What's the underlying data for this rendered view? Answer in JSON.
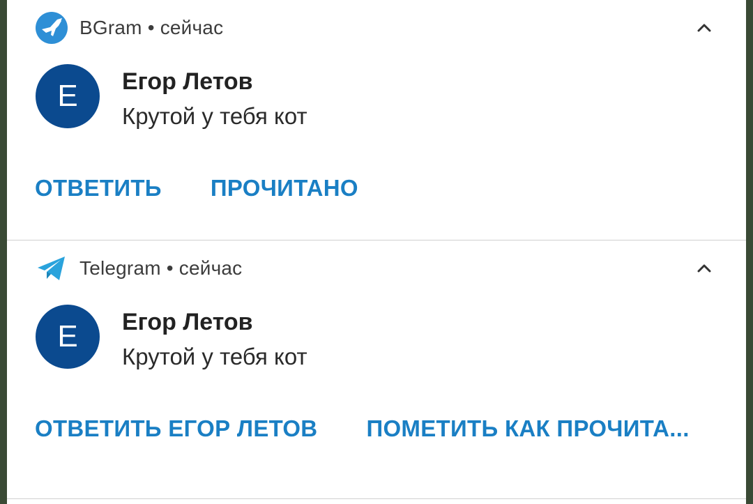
{
  "colors": {
    "accent": "#1a7fc4",
    "avatar_bg": "#0b4a8f",
    "bgram_icon": "#2e8fd6",
    "telegram_icon": "#2aa3dc"
  },
  "notifications": [
    {
      "app_name": "BGram",
      "time_sep": "•",
      "time": "сейчас",
      "app_icon": "bgram-bird-icon",
      "avatar_letter": "Е",
      "sender": "Егор Летов",
      "message": "Крутой у тебя кот",
      "actions": [
        "ОТВЕТИТЬ",
        "ПРОЧИТАНО"
      ]
    },
    {
      "app_name": "Telegram",
      "time_sep": "•",
      "time": "сейчас",
      "app_icon": "telegram-paper-plane-icon",
      "avatar_letter": "Е",
      "sender": "Егор Летов",
      "message": "Крутой у тебя кот",
      "actions": [
        "ОТВЕТИТЬ ЕГОР ЛЕТОВ",
        "ПОМЕТИТЬ КАК ПРОЧИТА..."
      ]
    }
  ]
}
